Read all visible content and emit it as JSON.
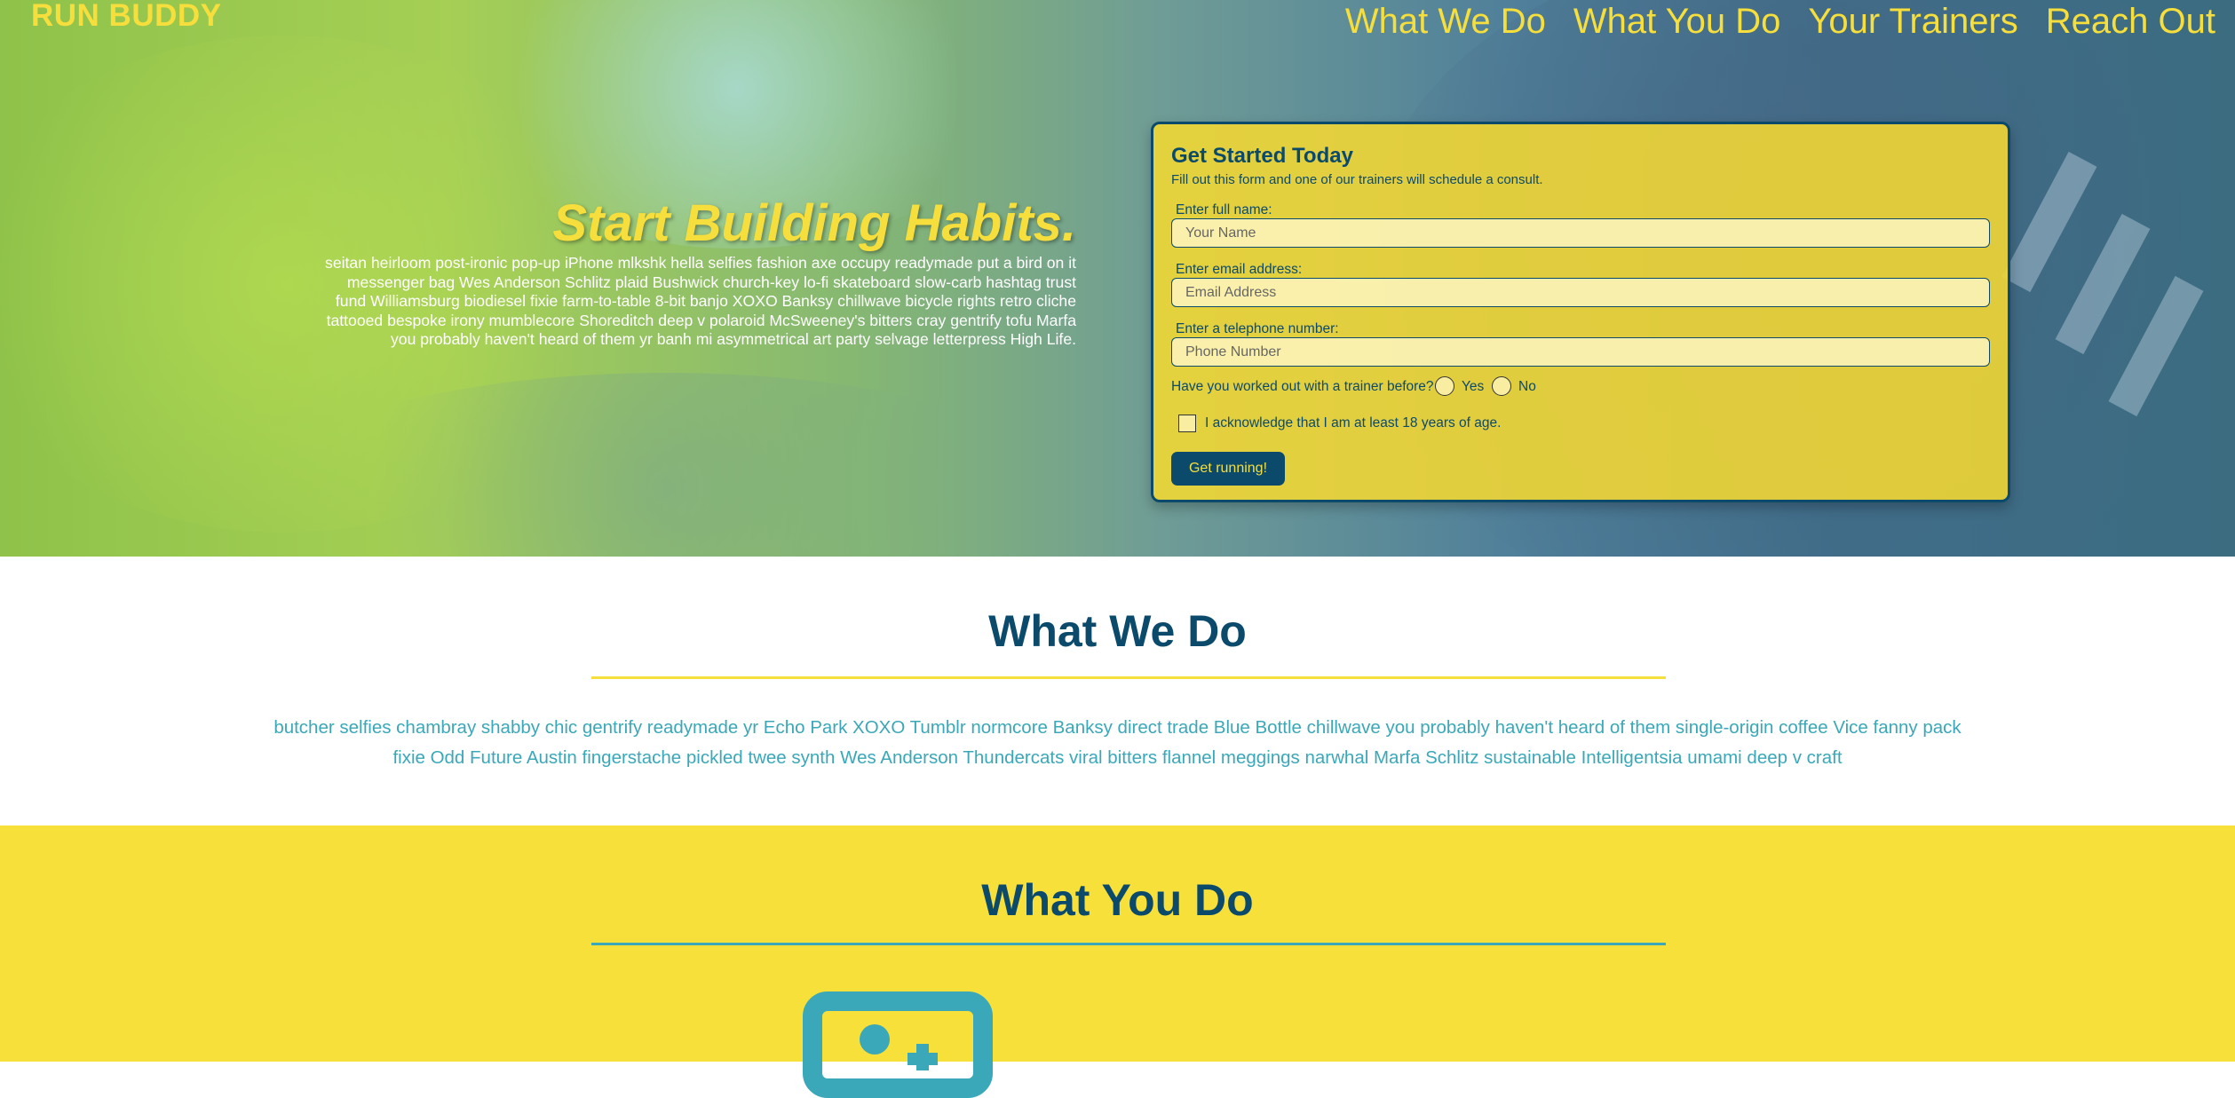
{
  "header": {
    "brand": "RUN BUDDY",
    "nav": [
      "What We Do",
      "What You Do",
      "Your Trainers",
      "Reach Out"
    ]
  },
  "hero": {
    "headline": "Start Building Habits.",
    "body": "seitan heirloom post-ironic pop-up iPhone mlkshk hella selfies fashion axe occupy readymade put a bird on it messenger bag Wes Anderson Schlitz plaid Bushwick church-key lo-fi skateboard slow-carb hashtag trust fund Williamsburg biodiesel fixie farm-to-table 8-bit banjo XOXO Banksy chillwave bicycle rights retro cliche tattooed bespoke irony mumblecore Shoreditch deep v polaroid McSweeney's bitters cray gentrify tofu Marfa you probably haven't heard of them yr banh mi asymmetrical art party selvage letterpress High Life."
  },
  "form": {
    "title": "Get Started Today",
    "subtitle": "Fill out this form and one of our trainers will schedule a consult.",
    "name_label": "Enter full name:",
    "name_placeholder": "Your Name",
    "email_label": "Enter email address:",
    "email_placeholder": "Email Address",
    "phone_label": "Enter a telephone number:",
    "phone_placeholder": "Phone Number",
    "question": "Have you worked out with a trainer before?",
    "yes_label": "Yes",
    "no_label": "No",
    "acknowledge": "I acknowledge that I am at least 18 years of age.",
    "submit_label": "Get running!"
  },
  "what_we_do": {
    "title": "What We Do",
    "body": "butcher selfies chambray shabby chic gentrify readymade yr Echo Park XOXO Tumblr normcore Banksy direct trade Blue Bottle chillwave you probably haven't heard of them single-origin coffee Vice fanny pack fixie Odd Future Austin fingerstache pickled twee synth Wes Anderson Thundercats viral bitters flannel meggings narwhal Marfa Schlitz sustainable Intelligentsia umami deep v craft"
  },
  "what_you_do": {
    "title": "What You Do",
    "icon": "add-user-icon"
  },
  "colors": {
    "brand_yellow": "#f6de3c",
    "navy": "#0b4a6b",
    "teal": "#3aa8b8",
    "section_yellow": "#f8e03a"
  }
}
